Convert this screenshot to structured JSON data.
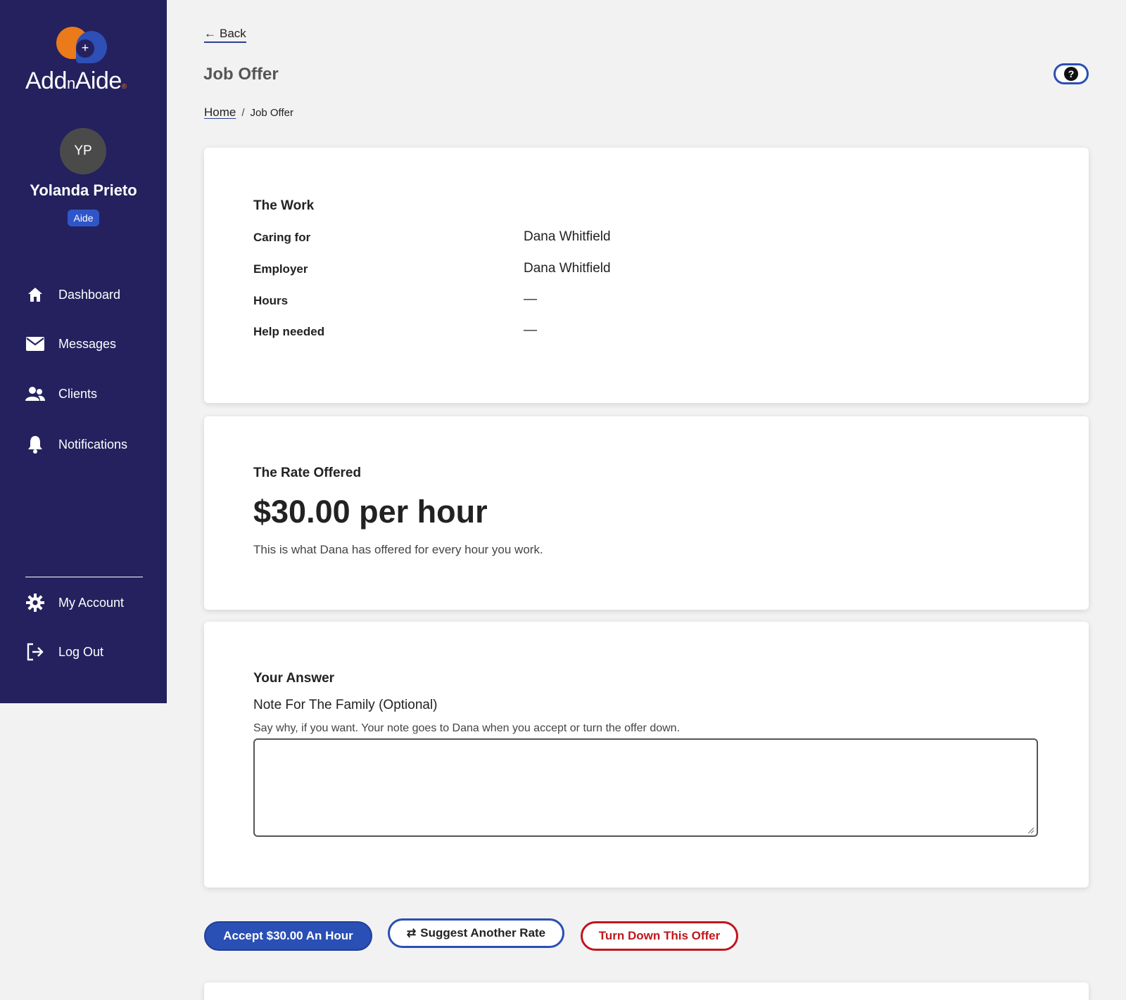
{
  "app": {
    "brand_name_a": "Add",
    "brand_name_n": "n",
    "brand_name_b": "Aide",
    "colors": {
      "sidebar": "#24215e",
      "accent": "#2a4fb5",
      "danger": "#c0161c",
      "logo_orange": "#ea7a1a"
    }
  },
  "user": {
    "initials": "YP",
    "name": "Yolanda Prieto",
    "role": "Aide"
  },
  "sidebar": {
    "items": [
      {
        "label": "Dashboard",
        "icon": "home-icon"
      },
      {
        "label": "Messages",
        "icon": "envelope-icon"
      },
      {
        "label": "Clients",
        "icon": "users-icon"
      },
      {
        "label": "Notifications",
        "icon": "bell-icon"
      }
    ],
    "bottom_items": [
      {
        "label": "My Account",
        "icon": "gear-icon"
      },
      {
        "label": "Log Out",
        "icon": "logout-icon"
      }
    ]
  },
  "header": {
    "back_label": "Back",
    "title": "Job Offer",
    "help_symbol": "?"
  },
  "breadcrumb": {
    "home": "Home",
    "separator": "/",
    "current": "Job Offer"
  },
  "work": {
    "heading": "The Work",
    "rows": [
      {
        "label": "Caring for",
        "value": "Dana Whitfield"
      },
      {
        "label": "Employer",
        "value": "Dana Whitfield"
      },
      {
        "label": "Hours",
        "value": "—"
      },
      {
        "label": "Help needed",
        "value": "—"
      }
    ]
  },
  "rate": {
    "heading": "The Rate Offered",
    "amount": "$30.00 per hour",
    "description": "This is what Dana has offered for every hour you work."
  },
  "answer": {
    "heading": "Your Answer",
    "note_label": "Note For The Family (Optional)",
    "note_help": "Say why, if you want. Your note goes to Dana when you accept or turn the offer down.",
    "note_value": "",
    "note_placeholder": ""
  },
  "actions": {
    "accept": "Accept $30.00 An Hour",
    "suggest": "Suggest Another Rate",
    "decline": "Turn Down This Offer"
  }
}
